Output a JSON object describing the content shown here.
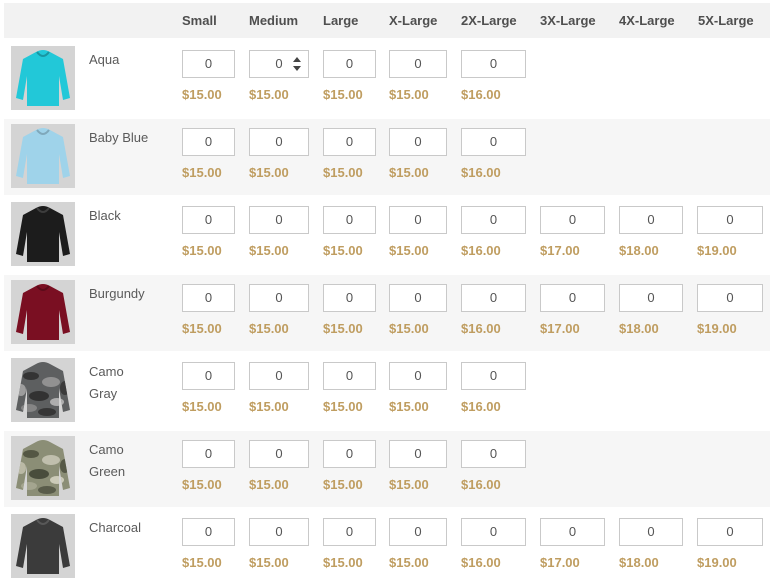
{
  "sizes": [
    "Small",
    "Medium",
    "Large",
    "X-Large",
    "2X-Large",
    "3X-Large",
    "4X-Large",
    "5X-Large"
  ],
  "rows": [
    {
      "name": "Aqua",
      "garment_color": "#22c8d8",
      "qty": [
        "0",
        "0",
        "0",
        "0",
        "0"
      ],
      "prices": [
        "$15.00",
        "$15.00",
        "$15.00",
        "$15.00",
        "$16.00"
      ]
    },
    {
      "name": "Baby Blue",
      "garment_color": "#9fd3ea",
      "qty": [
        "0",
        "0",
        "0",
        "0",
        "0"
      ],
      "prices": [
        "$15.00",
        "$15.00",
        "$15.00",
        "$15.00",
        "$16.00"
      ]
    },
    {
      "name": "Black",
      "garment_color": "#1c1c1c",
      "qty": [
        "0",
        "0",
        "0",
        "0",
        "0",
        "0",
        "0",
        "0"
      ],
      "prices": [
        "$15.00",
        "$15.00",
        "$15.00",
        "$15.00",
        "$16.00",
        "$17.00",
        "$18.00",
        "$19.00"
      ]
    },
    {
      "name": "Burgundy",
      "garment_color": "#7a0f22",
      "qty": [
        "0",
        "0",
        "0",
        "0",
        "0",
        "0",
        "0",
        "0"
      ],
      "prices": [
        "$15.00",
        "$15.00",
        "$15.00",
        "$15.00",
        "$16.00",
        "$17.00",
        "$18.00",
        "$19.00"
      ]
    },
    {
      "name_lines": [
        "Camo",
        "Gray"
      ],
      "garment_color": "#5d5f60",
      "qty": [
        "0",
        "0",
        "0",
        "0",
        "0"
      ],
      "prices": [
        "$15.00",
        "$15.00",
        "$15.00",
        "$15.00",
        "$16.00"
      ]
    },
    {
      "name_lines": [
        "Camo",
        "Green"
      ],
      "garment_color": "#8b8e76",
      "qty": [
        "0",
        "0",
        "0",
        "0",
        "0"
      ],
      "prices": [
        "$15.00",
        "$15.00",
        "$15.00",
        "$15.00",
        "$16.00"
      ]
    },
    {
      "name": "Charcoal",
      "garment_color": "#3b3b3b",
      "qty": [
        "0",
        "0",
        "0",
        "0",
        "0",
        "0",
        "0",
        "0"
      ],
      "prices": [
        "$15.00",
        "$15.00",
        "$15.00",
        "$15.00",
        "$16.00",
        "$17.00",
        "$18.00",
        "$19.00"
      ]
    }
  ],
  "colors": {
    "price": "#bf9d60",
    "header_bg": "#f2f2f2",
    "alt_row_bg": "#f6f6f6"
  },
  "icons": {
    "thumb": "hoodie-icon",
    "stepper": "spinner-icon"
  }
}
